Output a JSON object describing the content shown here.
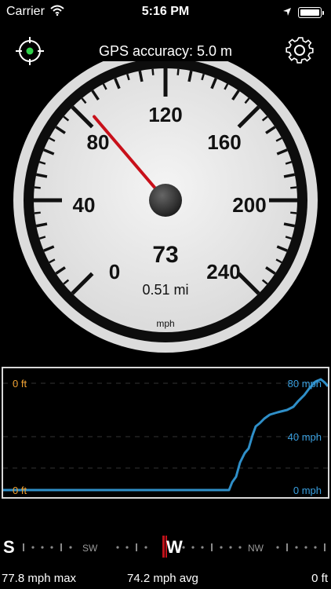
{
  "status_bar": {
    "carrier": "Carrier",
    "time": "5:16 PM",
    "wifi_icon": "wifi-icon",
    "location_icon": "location-arrow-icon",
    "battery_icon": "battery-icon"
  },
  "top_bar": {
    "gps_accuracy": "GPS accuracy: 5.0 m",
    "target_icon": "gps-target-icon",
    "settings_icon": "gear-icon"
  },
  "speedometer": {
    "speed": "73",
    "distance": "0.51 mi",
    "unit": "mph",
    "needle_value": 84,
    "scale_min": 0,
    "scale_max": 240,
    "scale_labels": [
      "0",
      "40",
      "80",
      "120",
      "160",
      "200",
      "240"
    ]
  },
  "graph": {
    "altitude_top": "0 ft",
    "altitude_bottom": "0 ft",
    "speed_top": "80 mph",
    "speed_mid": "40 mph",
    "speed_bottom": "0 mph",
    "colors": {
      "altitude": "#f0a030",
      "speed": "#2f8fc8"
    }
  },
  "compass": {
    "left_big": "S",
    "left_small": "SW",
    "center_big": "W",
    "right_small": "NW",
    "needle_color": "#c0121a"
  },
  "stats": {
    "max": "77.8 mph max",
    "avg": "74.2 mph avg",
    "altitude": "0 ft"
  }
}
